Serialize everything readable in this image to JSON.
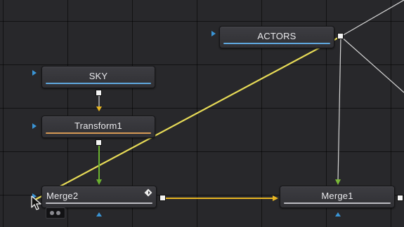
{
  "nodes": {
    "actors": {
      "label": "ACTORS"
    },
    "sky": {
      "label": "SKY"
    },
    "transform1": {
      "label": "Transform1"
    },
    "merge2": {
      "label": "Merge2"
    },
    "merge1": {
      "label": "Merge1"
    }
  },
  "icons": {
    "keyframe": "keyframe-diamond-icon",
    "cursor": "mouse-pointer-icon",
    "view_badge": "view-indicator-icon"
  },
  "colors": {
    "background": "#28282b",
    "input_port": "#3a95d6",
    "wire_background": "#e0d24a",
    "wire_foreground": "#6bb12f",
    "wire_effect": "#dddddd",
    "wire_merge": "#e8b622"
  }
}
